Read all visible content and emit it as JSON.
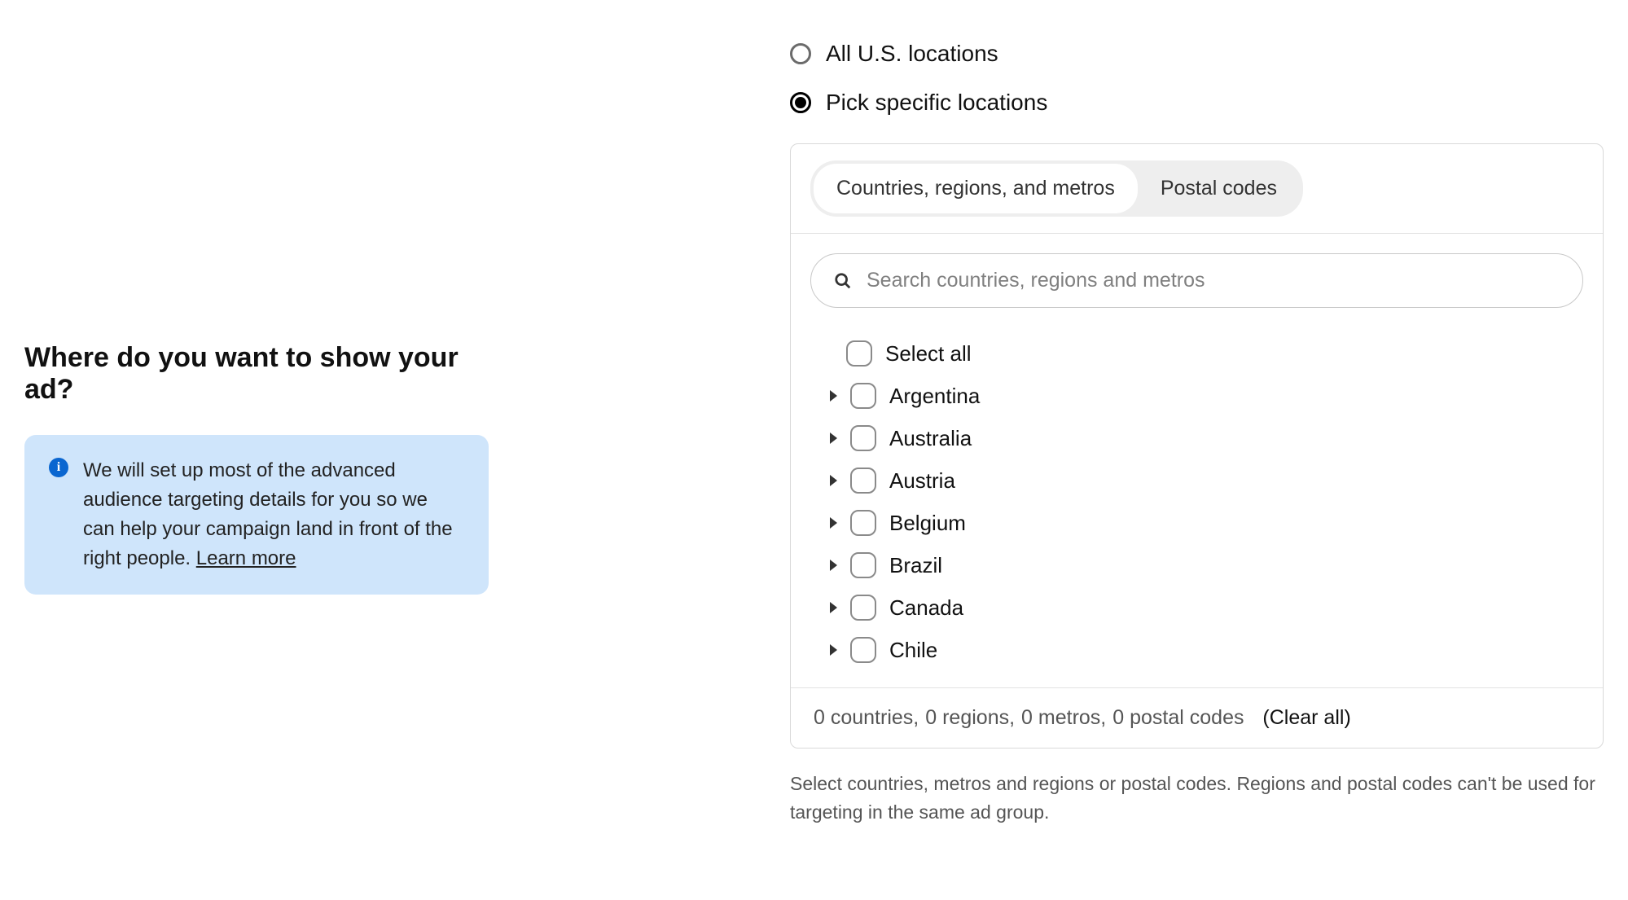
{
  "left": {
    "title": "Where do you want to show your ad?",
    "info_text": "We will set up most of the advanced audience targeting details for you so we can help your campaign land in front of the right people. ",
    "info_link_label": "Learn more"
  },
  "locations": {
    "radio_options": [
      {
        "label": "All U.S. locations",
        "selected": false
      },
      {
        "label": "Pick specific locations",
        "selected": true
      }
    ],
    "tabs": [
      {
        "label": "Countries, regions, and metros",
        "active": true
      },
      {
        "label": "Postal codes",
        "active": false
      }
    ],
    "search_placeholder": "Search countries, regions and metros",
    "select_all_label": "Select all",
    "countries": [
      {
        "label": "Argentina"
      },
      {
        "label": "Australia"
      },
      {
        "label": "Austria"
      },
      {
        "label": "Belgium"
      },
      {
        "label": "Brazil"
      },
      {
        "label": "Canada"
      },
      {
        "label": "Chile"
      }
    ],
    "summary": {
      "countries_count": "0 countries,",
      "regions_count": "0 regions,",
      "metros_count": "0 metros,",
      "postal_codes_count": "0 postal codes",
      "clear_all_label": "(Clear all)"
    },
    "help_text": "Select countries, metros and regions or postal codes. Regions and postal codes can't be used for targeting in the same ad group."
  }
}
